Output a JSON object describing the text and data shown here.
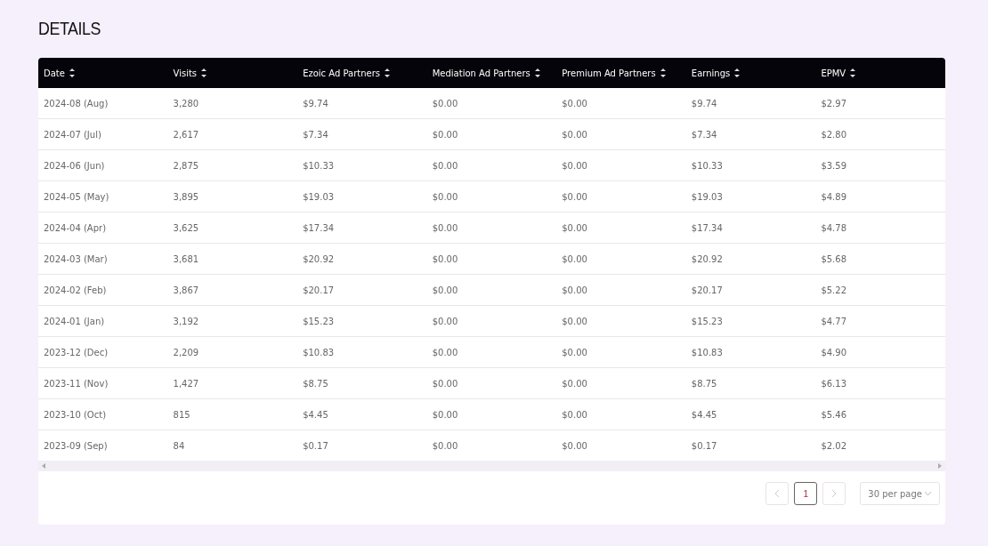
{
  "title": "DETAILS",
  "table": {
    "columns": [
      "Date",
      "Visits",
      "Ezoic Ad Partners",
      "Mediation Ad Partners",
      "Premium Ad Partners",
      "Earnings",
      "EPMV"
    ],
    "rows": [
      [
        "2024-08 (Aug)",
        "3,280",
        "$9.74",
        "$0.00",
        "$0.00",
        "$9.74",
        "$2.97"
      ],
      [
        "2024-07 (Jul)",
        "2,617",
        "$7.34",
        "$0.00",
        "$0.00",
        "$7.34",
        "$2.80"
      ],
      [
        "2024-06 (Jun)",
        "2,875",
        "$10.33",
        "$0.00",
        "$0.00",
        "$10.33",
        "$3.59"
      ],
      [
        "2024-05 (May)",
        "3,895",
        "$19.03",
        "$0.00",
        "$0.00",
        "$19.03",
        "$4.89"
      ],
      [
        "2024-04 (Apr)",
        "3,625",
        "$17.34",
        "$0.00",
        "$0.00",
        "$17.34",
        "$4.78"
      ],
      [
        "2024-03 (Mar)",
        "3,681",
        "$20.92",
        "$0.00",
        "$0.00",
        "$20.92",
        "$5.68"
      ],
      [
        "2024-02 (Feb)",
        "3,867",
        "$20.17",
        "$0.00",
        "$0.00",
        "$20.17",
        "$5.22"
      ],
      [
        "2024-01 (Jan)",
        "3,192",
        "$15.23",
        "$0.00",
        "$0.00",
        "$15.23",
        "$4.77"
      ],
      [
        "2023-12 (Dec)",
        "2,209",
        "$10.83",
        "$0.00",
        "$0.00",
        "$10.83",
        "$4.90"
      ],
      [
        "2023-11 (Nov)",
        "1,427",
        "$8.75",
        "$0.00",
        "$0.00",
        "$8.75",
        "$6.13"
      ],
      [
        "2023-10 (Oct)",
        "815",
        "$4.45",
        "$0.00",
        "$0.00",
        "$4.45",
        "$5.46"
      ],
      [
        "2023-09 (Sep)",
        "84",
        "$0.17",
        "$0.00",
        "$0.00",
        "$0.17",
        "$2.02"
      ]
    ]
  },
  "pagination": {
    "prev": {
      "disabled": true
    },
    "pages": [
      {
        "label": "1",
        "selected": true
      }
    ],
    "next": {
      "disabled": true
    },
    "per_page": "30 per page"
  }
}
